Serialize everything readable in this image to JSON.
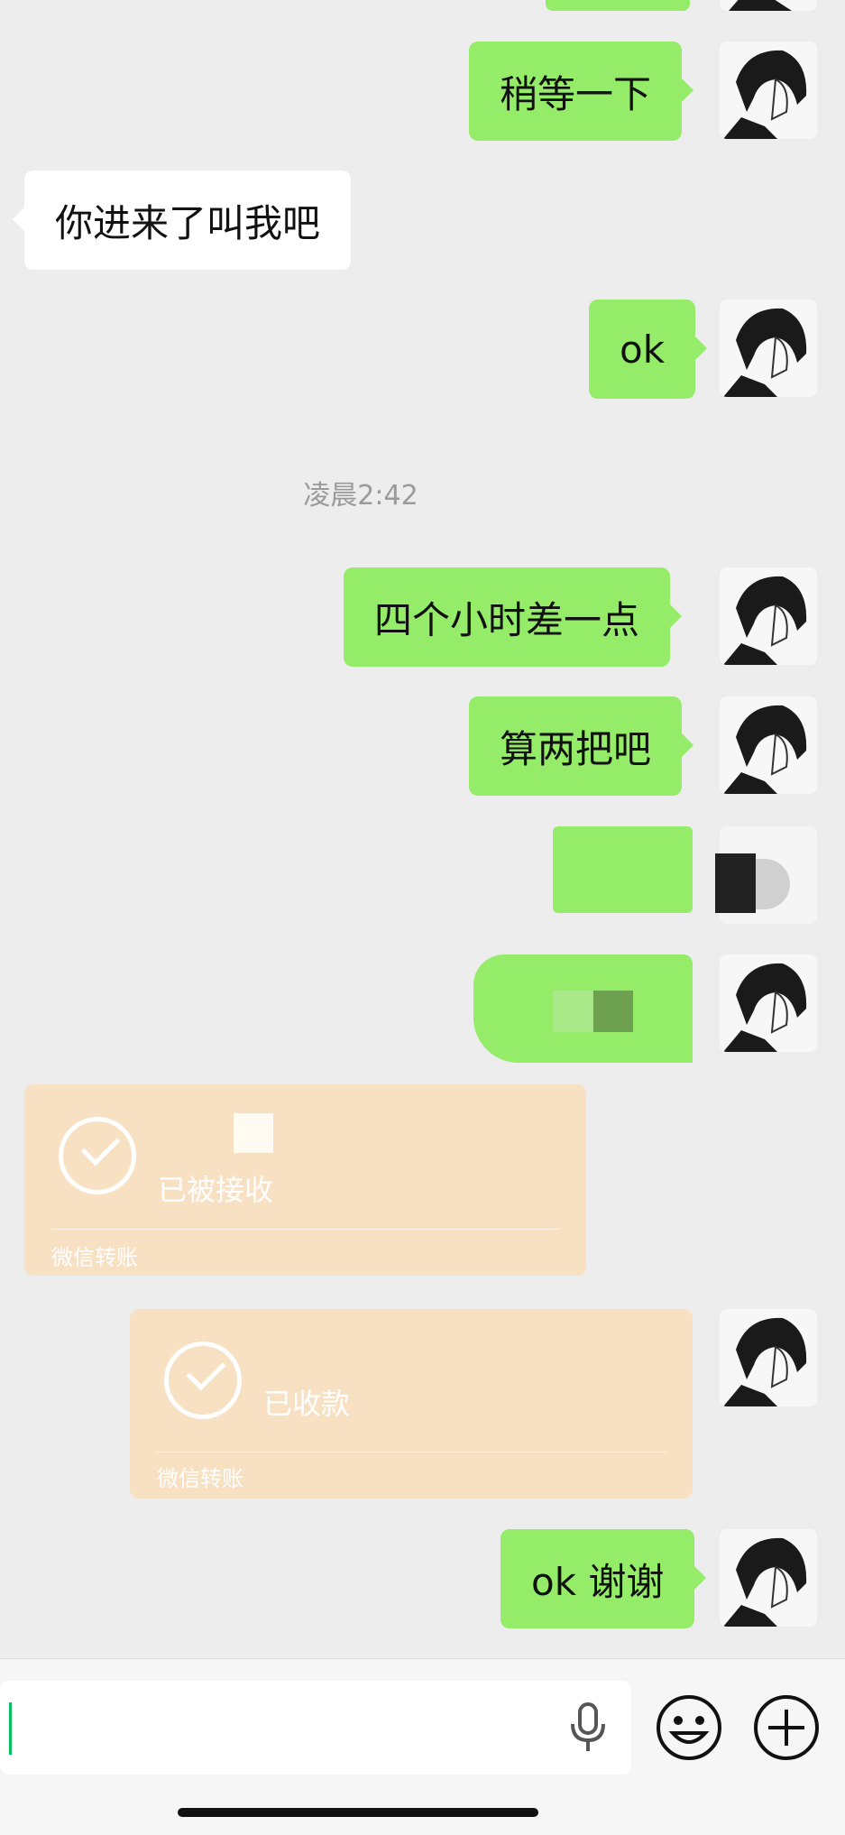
{
  "messages": [
    {
      "id": "m1",
      "side": "out",
      "text": "稍等一下"
    },
    {
      "id": "m2",
      "side": "in",
      "text": "你进来了叫我吧"
    },
    {
      "id": "m3",
      "side": "out",
      "text": "ok"
    },
    {
      "id": "m4",
      "side": "out",
      "text": "四个小时差一点"
    },
    {
      "id": "m5",
      "side": "out",
      "text": "算两把吧"
    },
    {
      "id": "m6",
      "side": "out",
      "text": "ok 谢谢"
    }
  ],
  "timestamp": "凌晨2:42",
  "transfers": [
    {
      "id": "t1",
      "side": "in",
      "status": "已被接收",
      "footer": "微信转账"
    },
    {
      "id": "t2",
      "side": "out",
      "status": "已收款",
      "footer": "微信转账"
    }
  ],
  "input": {
    "value": ""
  },
  "icons": {
    "voice": "microphone-icon",
    "emoji": "emoji-icon",
    "more": "plus-circle-icon"
  },
  "colors": {
    "bubble_out": "#95ec69",
    "bubble_in": "#ffffff",
    "transfer": "#f8e0c3",
    "background": "#ededed"
  }
}
